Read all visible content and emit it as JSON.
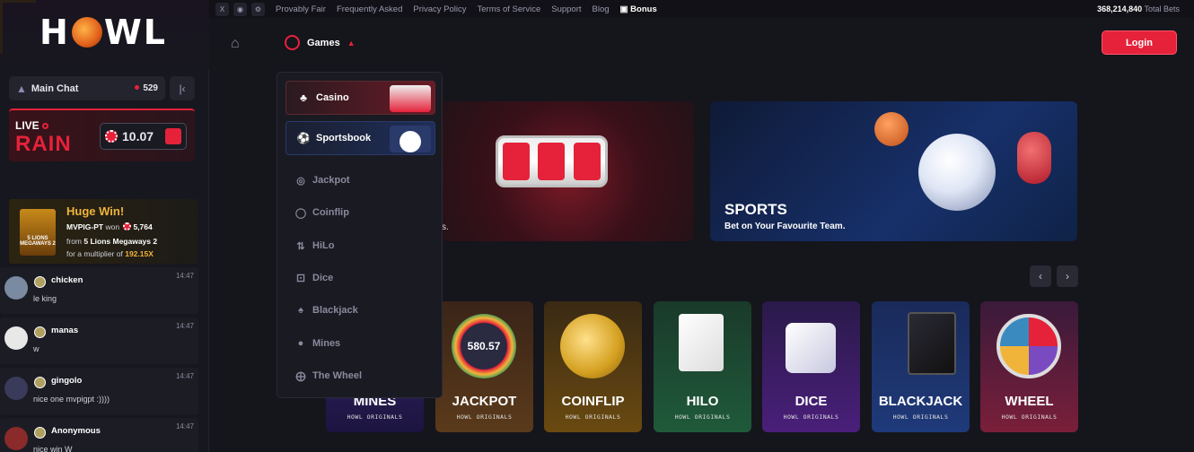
{
  "brand": {
    "logo_text_left": "H",
    "logo_text_right": "WL"
  },
  "topbar": {
    "links": [
      "Provably Fair",
      "Frequently Asked",
      "Privacy Policy",
      "Terms of Service",
      "Support",
      "Blog",
      "Bonus"
    ],
    "total_bets_value": "368,214,840",
    "total_bets_label": "Total Bets"
  },
  "nav": {
    "games_label": "Games",
    "login_label": "Login"
  },
  "sidebar": {
    "chat_label": "Main Chat",
    "online_count": "529",
    "rain": {
      "live_label": "LIVE",
      "rain_label": "RAIN",
      "amount": "10.07"
    },
    "big_win": {
      "title": "Huge Win!",
      "user": "MVPIG-PT",
      "won_text": "won",
      "amount": "5,764",
      "from_text": "from",
      "game": "5 Lions Megaways 2",
      "thumb_label": "5 LIONS MEGAWAYS 2",
      "multiplier_text": "for a multiplier of",
      "multiplier": "192.15X"
    },
    "messages": [
      {
        "name": "chicken",
        "time": "14:47",
        "text": "le king"
      },
      {
        "name": "manas",
        "time": "14:47",
        "text": "w"
      },
      {
        "name": "gingolo",
        "time": "14:47",
        "text": "nice one mvpigpt :))))"
      },
      {
        "name": "Anonymous",
        "time": "14:47",
        "text": "nice win W"
      }
    ]
  },
  "dropdown": {
    "top_items": [
      {
        "label": "Casino",
        "icon": "cherry-icon"
      },
      {
        "label": "Sportsbook",
        "icon": "football-icon"
      }
    ],
    "items": [
      {
        "label": "Jackpot",
        "icon": "jackpot-icon"
      },
      {
        "label": "Coinflip",
        "icon": "coinflip-icon"
      },
      {
        "label": "HiLo",
        "icon": "hilo-icon"
      },
      {
        "label": "Dice",
        "icon": "dice-icon"
      },
      {
        "label": "Blackjack",
        "icon": "blackjack-icon"
      },
      {
        "label": "Mines",
        "icon": "mines-icon"
      },
      {
        "label": "The Wheel",
        "icon": "wheel-icon"
      }
    ]
  },
  "banners": {
    "casino_subtext": "s.",
    "sports_title": "SPORTS",
    "sports_subtitle": "Bet on Your Favourite Team."
  },
  "game_cards": [
    {
      "name": "MINES",
      "sub": "HOWL ORIGINALS",
      "color": "#3a2a6a"
    },
    {
      "name": "JACKPOT",
      "sub": "HOWL ORIGINALS",
      "color": "#5a3a1a"
    },
    {
      "name": "COINFLIP",
      "sub": "HOWL ORIGINALS",
      "color": "#6a4a10"
    },
    {
      "name": "HILO",
      "sub": "HOWL ORIGINALS",
      "color": "#1f5a3a"
    },
    {
      "name": "DICE",
      "sub": "HOWL ORIGINALS",
      "color": "#4a1f7a"
    },
    {
      "name": "BLACKJACK",
      "sub": "HOWL ORIGINALS",
      "color": "#1f3a7a"
    },
    {
      "name": "WHEEL",
      "sub": "HOWL ORIGINALS",
      "color": "#7a1f3a"
    }
  ],
  "jackpot_value": "580.57",
  "colors": {
    "accent": "#e5223a",
    "gold": "#f0b43a"
  }
}
